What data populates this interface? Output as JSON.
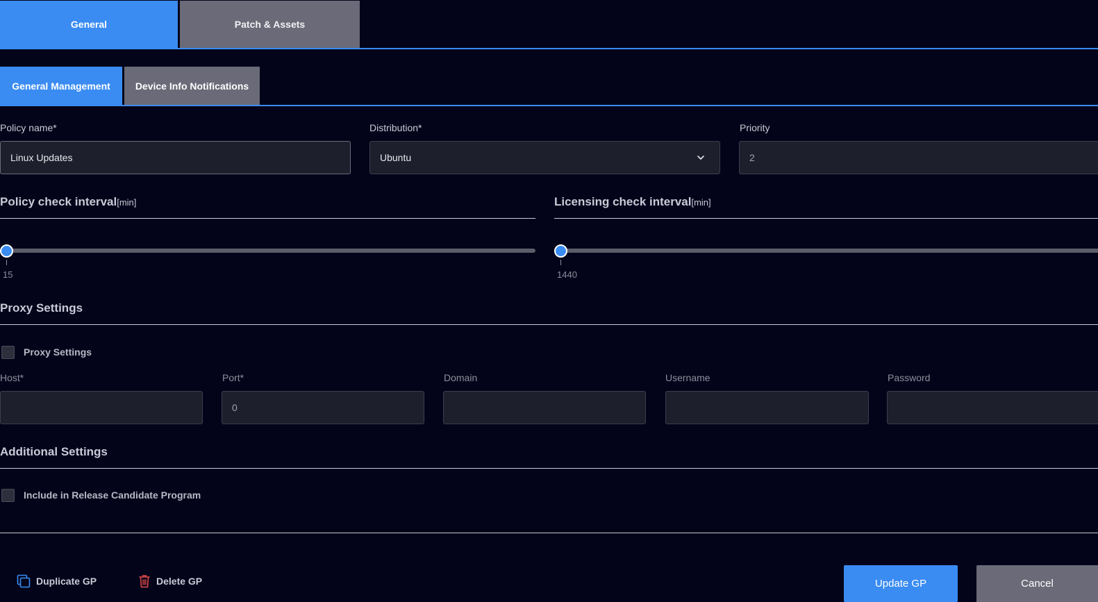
{
  "top_tabs": [
    {
      "label": "General",
      "active": true
    },
    {
      "label": "Patch & Assets",
      "active": false
    }
  ],
  "sub_tabs": [
    {
      "label": "General Management",
      "active": true
    },
    {
      "label": "Device Info Notifications",
      "active": false
    }
  ],
  "general": {
    "policy_name_label": "Policy name*",
    "policy_name_value": "Linux Updates",
    "distribution_label": "Distribution*",
    "distribution_value": "Ubuntu",
    "priority_label": "Priority",
    "priority_value": "2"
  },
  "intervals": {
    "policy_check": {
      "title": "Policy check interval",
      "unit": "[min]",
      "value": "15",
      "level": 0
    },
    "licensing_check": {
      "title": "Licensing check interval",
      "unit": "[min]",
      "value": "1440",
      "level": 0
    }
  },
  "proxy": {
    "section_title": "Proxy Settings",
    "checkbox_label": "Proxy Settings",
    "checked": false,
    "host_label": "Host*",
    "host_value": "",
    "port_label": "Port*",
    "port_value": "0",
    "domain_label": "Domain",
    "domain_value": "",
    "username_label": "Username",
    "username_value": "",
    "password_label": "Password",
    "password_value": ""
  },
  "additional": {
    "section_title": "Additional Settings",
    "rc_label": "Include in Release Candidate Program",
    "rc_checked": false
  },
  "actions": {
    "duplicate_label": "Duplicate GP",
    "delete_label": "Delete GP",
    "update_label": "Update GP",
    "cancel_label": "Cancel"
  },
  "colors": {
    "background": "#03041a",
    "accent": "#3a8cf2",
    "inactive_tab": "#6b6a78",
    "field": "#1e1f2c",
    "delete_icon": "#e04848"
  }
}
